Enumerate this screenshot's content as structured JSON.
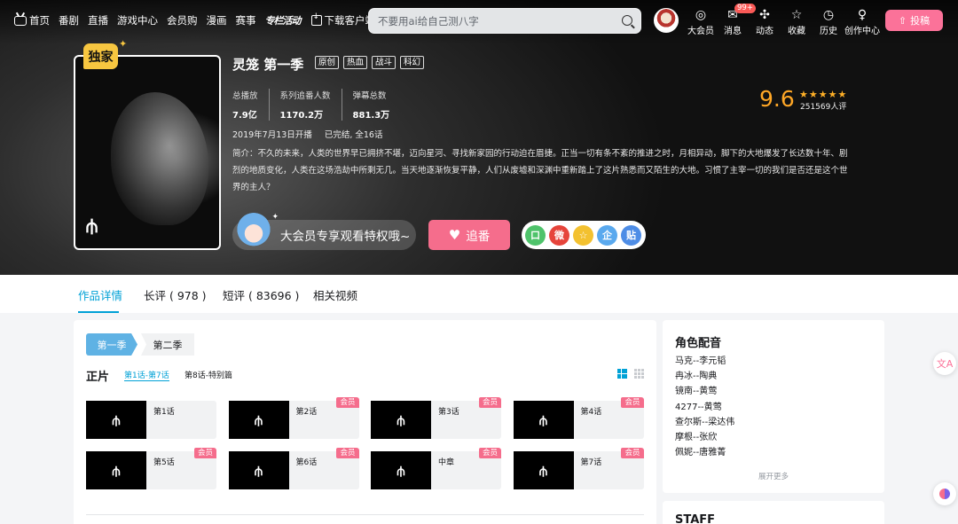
{
  "nav": {
    "items": [
      {
        "label": "首页",
        "icon": "tv-icon"
      },
      {
        "label": "番剧"
      },
      {
        "label": "直播"
      },
      {
        "label": "游戏中心"
      },
      {
        "label": "会员购"
      },
      {
        "label": "漫画"
      },
      {
        "label": "赛事"
      }
    ],
    "promo": "专栏活动",
    "download": "下载客户端",
    "search_placeholder": "不要用ai给自己测八字",
    "right_items": [
      {
        "label": "大会员",
        "glyph": "◎"
      },
      {
        "label": "消息",
        "glyph": "✉",
        "badge": "99+"
      },
      {
        "label": "动态",
        "glyph": "✣"
      },
      {
        "label": "收藏",
        "glyph": "☆"
      },
      {
        "label": "历史",
        "glyph": "◷"
      },
      {
        "label": "创作中心",
        "glyph": "♀"
      }
    ],
    "upload": "投稿"
  },
  "hero": {
    "exclusive": "独家",
    "title": "灵笼 第一季",
    "tags": [
      "原创",
      "热血",
      "战斗",
      "科幻"
    ],
    "stats": [
      {
        "label": "总播放",
        "value": "7.9亿"
      },
      {
        "label": "系列追番人数",
        "value": "1170.2万"
      },
      {
        "label": "弹幕总数",
        "value": "881.3万"
      }
    ],
    "air_date": "2019年7月13日开播",
    "status": "已完结, 全16话",
    "description": "简介：不久的未来，人类的世界早已拥挤不堪，迈向星河、寻找新家园的行动迫在眉捷。正当一切有条不紊的推进之时，月相异动，脚下的大地爆发了长达数十年、剧烈的地质变化，人类在这场浩劫中所剩无几。当天地逐渐恢复平静，人们从废墟和深渊中重新踏上了这片熟悉而又陌生的大地。习惯了主宰一切的我们是否还是这个世界的主人？",
    "score": "9.6",
    "stars": "★★★★★",
    "raters": "251569人评",
    "vip_text": "大会员专享观看特权哦~",
    "follow": "追番",
    "share": [
      "口",
      "微",
      "☆",
      "企",
      "贴"
    ]
  },
  "tabs": [
    "作品详情",
    "长评 ( 978 )",
    "短评 ( 83696 )",
    "相关视频"
  ],
  "episodes": {
    "seasons": [
      "第一季",
      "第二季"
    ],
    "section_title": "正片",
    "ranges": [
      "第1话-第7话",
      "第8话-特别篇"
    ],
    "list": [
      {
        "label": "第1话",
        "vip": ""
      },
      {
        "label": "第2话",
        "vip": "会员"
      },
      {
        "label": "第3话",
        "vip": "会员"
      },
      {
        "label": "第4话",
        "vip": "会员"
      },
      {
        "label": "第5话",
        "vip": "会员"
      },
      {
        "label": "第6话",
        "vip": "会员"
      },
      {
        "label": "中章",
        "vip": "会员"
      },
      {
        "label": "第7话",
        "vip": "会员"
      }
    ]
  },
  "cast": {
    "title": "角色配音",
    "entries": [
      "马克--李元韬",
      "冉冰--陶典",
      "镜南--黄莺",
      "4277--黄莺",
      "查尔斯--梁达伟",
      "摩根--张欣",
      "佩妮--唐雅菁"
    ],
    "more": "展开更多",
    "staff_title": "STAFF"
  },
  "colors": {
    "accent": "#00a1d6",
    "pink": "#fb7299",
    "score": "#ffa726"
  }
}
